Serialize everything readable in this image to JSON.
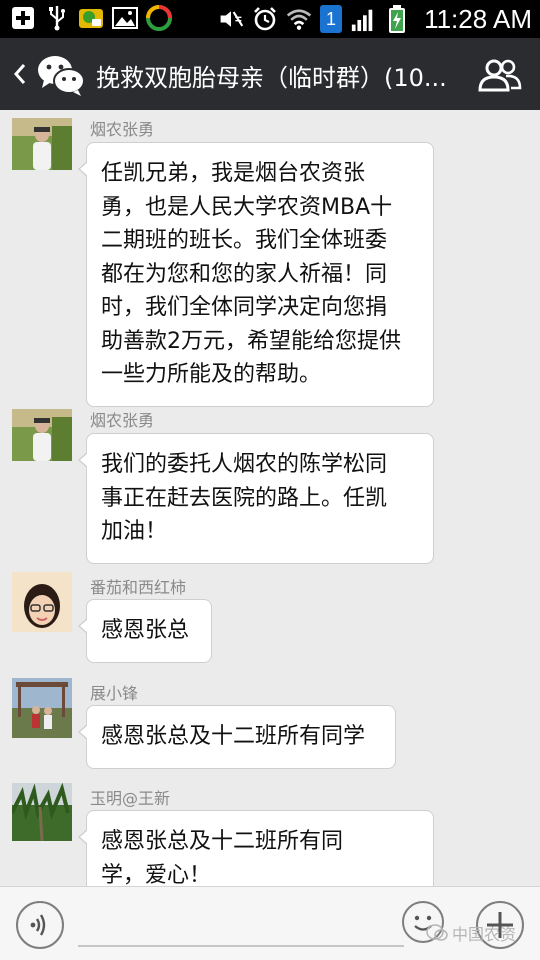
{
  "status_bar": {
    "time": "11:28 AM",
    "notification_badge": "1",
    "icons": [
      "plus-square-icon",
      "usb-icon",
      "app-icon",
      "image-icon",
      "sync-icon",
      "silent-icon",
      "alarm-icon",
      "wifi-icon",
      "signal-icon",
      "battery-charging-icon"
    ]
  },
  "nav": {
    "title": "挽救双胞胎母亲（临时群）(10..."
  },
  "messages": [
    {
      "sender": "烟农张勇",
      "lines": [
        "任凯兄弟，我是烟台农资张",
        "勇，也是人民大学农资MBA十",
        "二期班的班长。我们全体班委",
        "都在为您和您的家人祈福！同",
        "时，我们全体同学决定向您捐",
        "助善款2万元，希望能给您提供",
        "一些力所能及的帮助。"
      ]
    },
    {
      "sender": "烟农张勇",
      "lines": [
        "我们的委托人烟农的陈学松同",
        "事正在赶去医院的路上。任凯",
        "加油！"
      ]
    },
    {
      "sender": "番茄和西红柿",
      "lines": [
        "感恩张总"
      ]
    },
    {
      "sender": "展小锋",
      "lines": [
        "感恩张总及十二班所有同学"
      ]
    },
    {
      "sender": "玉明@王新",
      "lines": [
        "感恩张总及十二班所有同",
        "学，爱心！"
      ]
    }
  ],
  "bottom_bar": {
    "watermark": "中国农资"
  },
  "colors": {
    "nav_bg": "#2b2c30",
    "chat_bg": "#ebebeb",
    "bubble_bg": "#ffffff",
    "sender_text": "#8a8a8a"
  }
}
